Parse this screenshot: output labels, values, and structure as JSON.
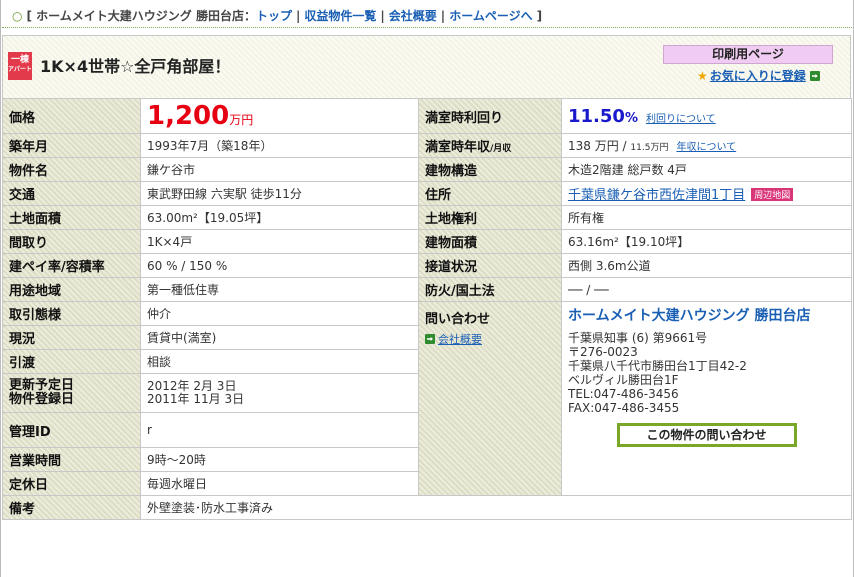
{
  "nav": {
    "bullet": "○",
    "prefix": "[ ホームメイト大建ハウジング 勝田台店：",
    "links": [
      "トップ",
      "収益物件一覧",
      "会社概要",
      "ホームページへ"
    ],
    "separator": "|",
    "suffix": "]"
  },
  "header": {
    "badge_top": "一棟",
    "badge_bottom": "アパート",
    "title": "1K×4世帯☆全戸角部屋！",
    "print_label": "印刷用ページ",
    "favorite_label": "お気に入りに登録"
  },
  "spec": {
    "price_label": "価格",
    "price_value": "1,200",
    "price_unit": "万円",
    "yield_label": "満室時利回り",
    "yield_value": "11.50",
    "yield_pct": "%",
    "yield_link": "利回りについて",
    "built_label": "築年月",
    "built_value": "1993年7月（築18年）",
    "income_label": "満室時年収",
    "income_label_sub": "/月収",
    "income_value": "138 万円 / ",
    "income_value_month": "11.5万円",
    "income_link": "年収について",
    "name_label": "物件名",
    "name_value": "鎌ケ谷市",
    "structure_label": "建物構造",
    "structure_value": "木造2階建 総戸数 4戸",
    "transport_label": "交通",
    "transport_value": "東武野田線 六実駅 徒歩11分",
    "address_label": "住所",
    "address_value": "千葉県鎌ケ谷市西佐津間1丁目",
    "map_tag": "周辺地図",
    "land_area_label": "土地面積",
    "land_area_value": "63.00m²【19.05坪】",
    "land_right_label": "土地権利",
    "land_right_value": "所有権",
    "layout_label": "間取り",
    "layout_value": "1K×4戸",
    "building_area_label": "建物面積",
    "building_area_value": "63.16m²【19.10坪】",
    "ratio_label": "建ペイ率/容積率",
    "ratio_value": "60 % / 150 %",
    "road_label": "接道状況",
    "road_value": "西側 3.6m公道",
    "zone_label": "用途地域",
    "zone_value": "第一種低住専",
    "fire_label": "防火/国土法",
    "fire_value": "── / ──",
    "deal_label": "取引態様",
    "deal_value": "仲介",
    "contact_label": "問い合わせ",
    "contact_link": "会社概要",
    "status_label": "現況",
    "status_value": "賃貸中(満室)",
    "handover_label": "引渡",
    "handover_value": "相談",
    "update_label": "更新予定日",
    "register_label": "物件登録日",
    "update_value": "2012年 2月 3日",
    "register_value": "2011年 11月 3日",
    "manage_label": "管理ID",
    "manage_value": "r",
    "hours_label": "営業時間",
    "hours_value": "9時～20時",
    "holiday_label": "定休日",
    "holiday_value": "毎週水曜日",
    "remarks_label": "備考",
    "remarks_value": "外壁塗装･防水工事済み"
  },
  "company": {
    "name": "ホームメイト大建ハウジング 勝田台店",
    "license": "千葉県知事 (6) 第9661号",
    "postal": "〒276-0023",
    "address1": "千葉県八千代市勝田台1丁目42-2",
    "address2": "ベルヴィル勝田台1F",
    "tel": "TEL:047-486-3456",
    "fax": "FAX:047-486-3455",
    "inquiry_button": "この物件の問い合わせ"
  },
  "colors": {
    "price": "#e60012",
    "yield": "#1a1acc",
    "link": "#1a5fb4",
    "inquiry_border": "#7aa728"
  }
}
